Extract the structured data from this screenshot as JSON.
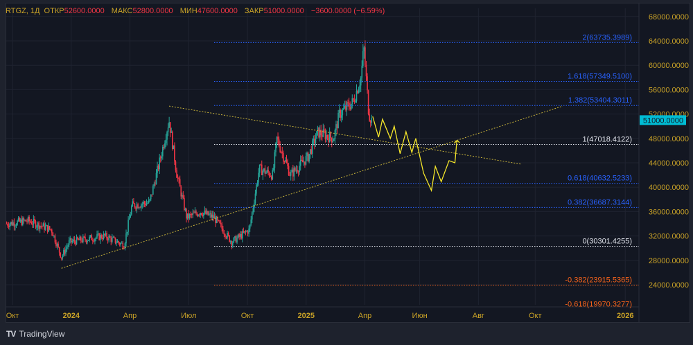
{
  "legend": {
    "symbol": "RTGZ, 1Д",
    "open_label": "ОТКР",
    "open": "52600.0000",
    "high_label": "МАКС",
    "high": "52800.0000",
    "low_label": "МИН",
    "low": "47600.0000",
    "close_label": "ЗАКР",
    "close": "51000.0000",
    "change": "−3600.0000 (−6.59%)"
  },
  "colors": {
    "bg": "#131722",
    "up": "#26a69a",
    "down": "#f23645",
    "axis_text": "#c9a227",
    "fib_blue": "#2962ff",
    "fib_white": "#e0e3eb",
    "fib_orange": "#f7631b",
    "trend": "#c9b43a",
    "projection": "#f5e62a",
    "last_price_bg": "#00bcd4"
  },
  "price_axis": {
    "labels": [
      "68000.0000",
      "64000.0000",
      "60000.0000",
      "56000.0000",
      "52000.0000",
      "48000.0000",
      "44000.0000",
      "40000.0000",
      "36000.0000",
      "32000.0000",
      "28000.0000",
      "24000.0000"
    ],
    "values": [
      68000,
      64000,
      60000,
      56000,
      52000,
      48000,
      44000,
      40000,
      36000,
      32000,
      28000,
      24000
    ],
    "last_price": "51000.0000",
    "last_value": 51000
  },
  "time_axis": [
    {
      "label": "Окт",
      "m": 0,
      "bold": false
    },
    {
      "label": "2024",
      "m": 3,
      "bold": true
    },
    {
      "label": "Апр",
      "m": 6,
      "bold": false
    },
    {
      "label": "Июл",
      "m": 9,
      "bold": false
    },
    {
      "label": "Окт",
      "m": 12,
      "bold": false
    },
    {
      "label": "2025",
      "m": 15,
      "bold": true
    },
    {
      "label": "Апр",
      "m": 18,
      "bold": false
    },
    {
      "label": "Июн",
      "m": 20.8,
      "bold": false
    },
    {
      "label": "Авг",
      "m": 23.8,
      "bold": false
    },
    {
      "label": "Окт",
      "m": 26.7,
      "bold": false
    },
    {
      "label": "2026",
      "m": 31.3,
      "bold": true
    }
  ],
  "fib_levels": [
    {
      "label": "2(63735.3989)",
      "price": 63735.3989,
      "color": "blue"
    },
    {
      "label": "1.618(57349.5100)",
      "price": 57349.51,
      "color": "blue"
    },
    {
      "label": "1.382(53404.3011)",
      "price": 53404.3011,
      "color": "blue"
    },
    {
      "label": "1(47018.4122)",
      "price": 47018.4122,
      "color": "white"
    },
    {
      "label": "0.618(40632.5233)",
      "price": 40632.5233,
      "color": "blue"
    },
    {
      "label": "0.382(36687.3144)",
      "price": 36687.3144,
      "color": "blue"
    },
    {
      "label": "0(30301.4255)",
      "price": 30301.4255,
      "color": "white"
    },
    {
      "label": "-0.382(23915.5365)",
      "price": 23915.5365,
      "color": "orange"
    },
    {
      "label": "-0.618(19970.3277)",
      "price": 19970.3277,
      "color": "orange",
      "label_only": true
    }
  ],
  "fib_start_m": 10.3,
  "trend_lines": [
    [
      [
        8.0,
        53300
      ],
      [
        26.0,
        43770
      ]
    ],
    [
      [
        2.5,
        26700
      ],
      [
        28.1,
        53300
      ]
    ]
  ],
  "projection": [
    [
      18.4,
      51600
    ],
    [
      18.7,
      48200
    ],
    [
      18.9,
      51150
    ],
    [
      19.3,
      48000
    ],
    [
      19.5,
      50000
    ],
    [
      19.8,
      45500
    ],
    [
      20.1,
      49100
    ],
    [
      20.4,
      45700
    ],
    [
      20.6,
      48000
    ],
    [
      21.0,
      42300
    ],
    [
      21.4,
      39450
    ],
    [
      21.6,
      43400
    ],
    [
      21.9,
      40900
    ],
    [
      22.3,
      44350
    ],
    [
      22.6,
      44000
    ],
    [
      22.7,
      47650
    ]
  ],
  "price_path": [
    [
      -0.3,
      34000
    ],
    [
      0.8,
      34500
    ],
    [
      2.0,
      33000
    ],
    [
      2.5,
      28500
    ],
    [
      2.9,
      31000
    ],
    [
      4.7,
      32000
    ],
    [
      5.7,
      30500
    ],
    [
      6.1,
      37000
    ],
    [
      7.0,
      37500
    ],
    [
      7.5,
      44000
    ],
    [
      8.0,
      51000
    ],
    [
      8.4,
      42000
    ],
    [
      8.9,
      35000
    ],
    [
      9.6,
      36000
    ],
    [
      10.3,
      35000
    ],
    [
      11.2,
      31000
    ],
    [
      12.1,
      33000
    ],
    [
      12.6,
      43000
    ],
    [
      13.3,
      42000
    ],
    [
      13.5,
      48000
    ],
    [
      14.2,
      42000
    ],
    [
      15.1,
      45000
    ],
    [
      15.6,
      49000
    ],
    [
      16.4,
      48000
    ],
    [
      16.7,
      52000
    ],
    [
      17.4,
      54000
    ],
    [
      17.8,
      58000
    ],
    [
      17.95,
      63000
    ],
    [
      18.2,
      52000
    ],
    [
      18.35,
      51000
    ]
  ],
  "brand": "TradingView"
}
